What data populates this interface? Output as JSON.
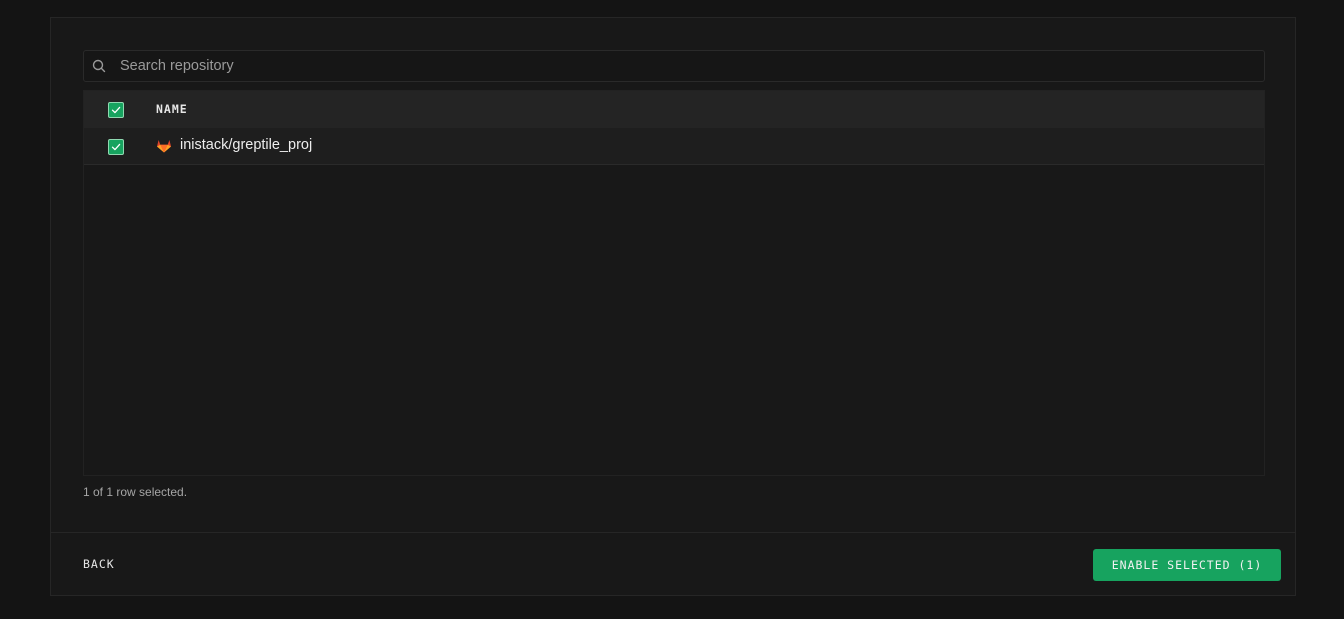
{
  "search": {
    "placeholder": "Search repository",
    "value": ""
  },
  "table": {
    "columns": [
      "NAME"
    ],
    "header_checked": true,
    "rows": [
      {
        "name": "inistack/greptile_proj",
        "icon": "gitlab-icon",
        "checked": true
      }
    ]
  },
  "selection_status": "1 of 1 row selected.",
  "footer": {
    "back_label": "BACK",
    "enable_label": "ENABLE SELECTED (1)"
  },
  "colors": {
    "accent": "#17a35f",
    "background": "#181818",
    "header": "#242424",
    "gitlab_orange": "#e2432a"
  }
}
